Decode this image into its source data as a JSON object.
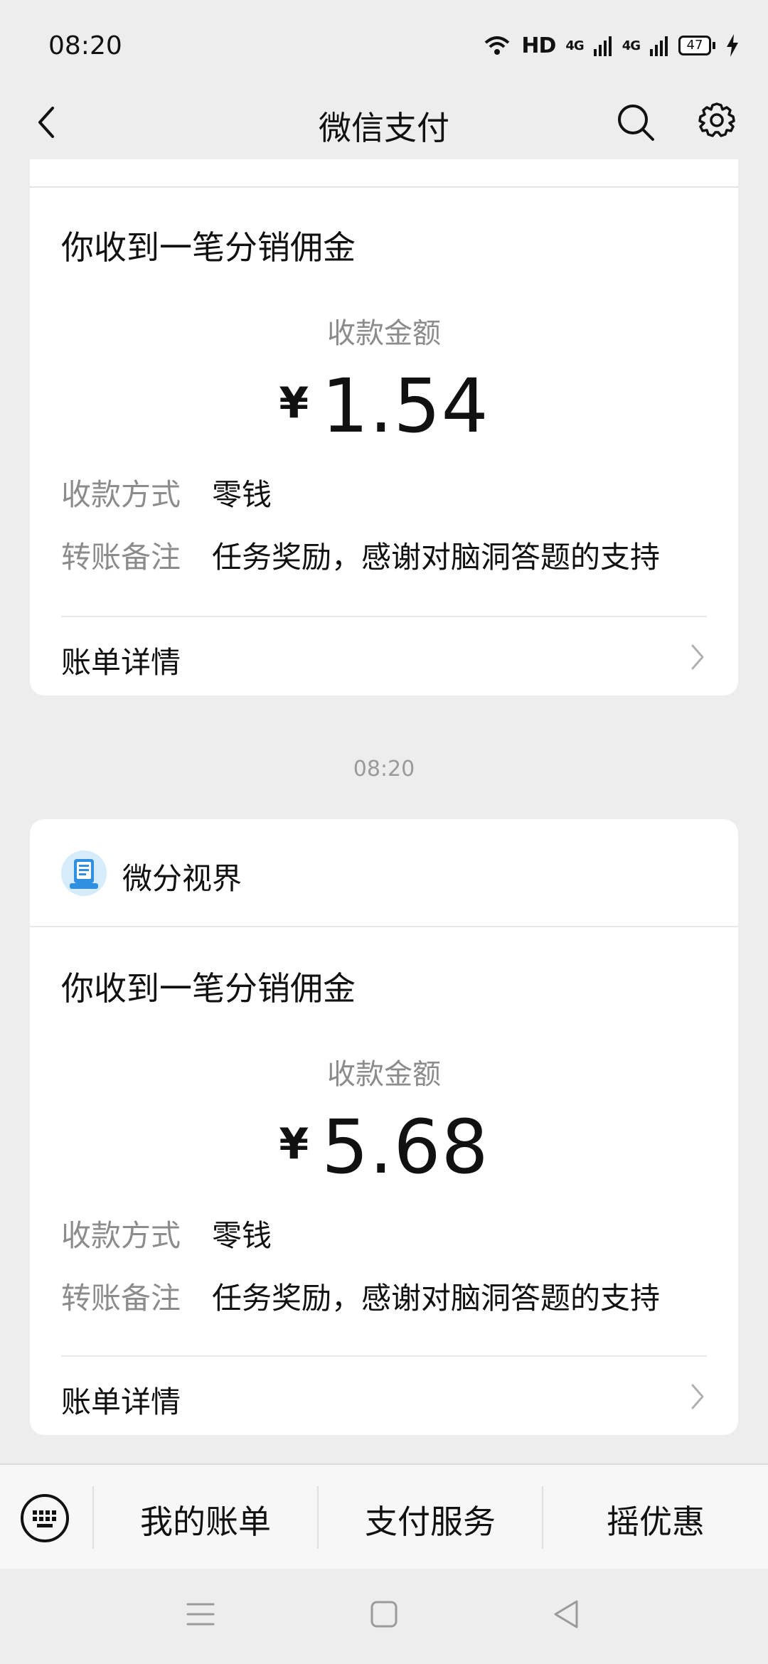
{
  "status_bar": {
    "time": "08:20",
    "network": "HD",
    "signal_1": "4G",
    "signal_2": "4G",
    "battery": "47"
  },
  "header": {
    "title": "微信支付"
  },
  "cards": [
    {
      "headline": "你收到一笔分销佣金",
      "amount_label": "收款金额",
      "currency": "¥",
      "amount": "1.54",
      "method_label": "收款方式",
      "method_value": "零钱",
      "note_label": "转账备注",
      "note_value": "任务奖励，感谢对脑洞答题的支持",
      "detail_label": "账单详情"
    },
    {
      "merchant": "微分视界",
      "headline": "你收到一笔分销佣金",
      "amount_label": "收款金额",
      "currency": "¥",
      "amount": "5.68",
      "method_label": "收款方式",
      "method_value": "零钱",
      "note_label": "转账备注",
      "note_value": "任务奖励，感谢对脑洞答题的支持",
      "detail_label": "账单详情"
    }
  ],
  "timestamp": "08:20",
  "bottom_menu": {
    "items": [
      "我的账单",
      "支付服务",
      "摇优惠"
    ]
  },
  "icons": {
    "back": "chevron-left-icon",
    "search": "search-icon",
    "settings": "gear-icon",
    "keyboard": "keyboard-icon",
    "detail": "chevron-right-icon",
    "nav_menu": "menu-icon",
    "nav_home": "square-icon",
    "nav_back": "triangle-back-icon"
  },
  "colors": {
    "background": "#ededed",
    "card": "#ffffff",
    "secondary_text": "#8c8c8c",
    "primary_text": "#111111"
  }
}
